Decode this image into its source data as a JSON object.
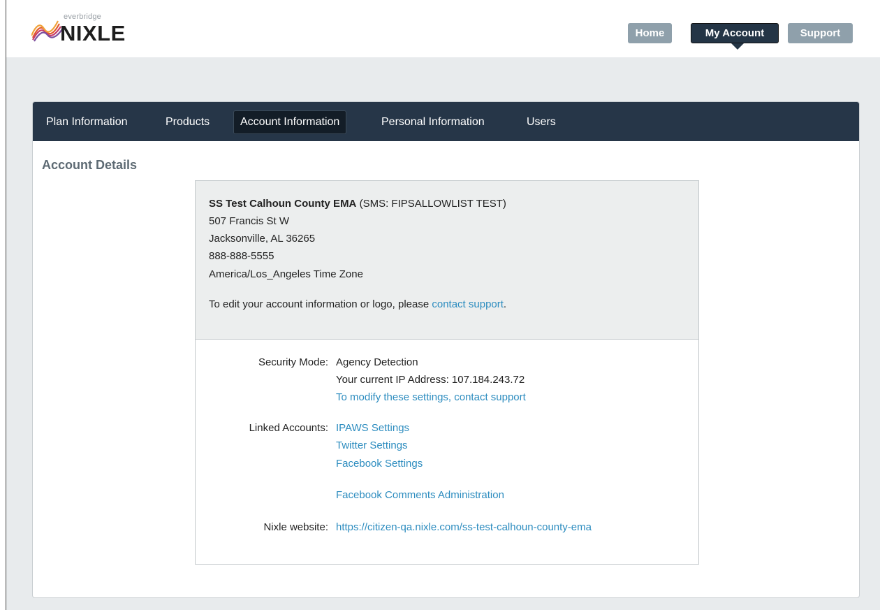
{
  "header": {
    "logo_small": "everbridge",
    "logo_big": "NIXLE",
    "nav": {
      "home": "Home",
      "my_account": "My Account",
      "support": "Support"
    }
  },
  "tabs": [
    "Plan Information",
    "Products",
    "Account Information",
    "Personal Information",
    "Users"
  ],
  "active_tab": "Account Information",
  "section_title": "Account Details",
  "account": {
    "name": "SS Test Calhoun County EMA",
    "sms_note": "(SMS: FIPSALLOWLIST TEST)",
    "address1": "507 Francis St W",
    "address2": "Jacksonville, AL 36265",
    "phone": "888-888-5555",
    "timezone": "America/Los_Angeles Time Zone",
    "edit_note": "To edit your account information or logo, please",
    "edit_link": "contact support",
    "edit_suffix": "."
  },
  "security": {
    "label": "Security Mode:",
    "mode": "Agency Detection",
    "ip_text": "Your current IP Address: 107.184.243.72",
    "modify_link": "To modify these settings, contact support"
  },
  "linked": {
    "label": "Linked Accounts:",
    "ipaws": "IPAWS Settings",
    "twitter": "Twitter Settings",
    "facebook": "Facebook Settings",
    "facebook_comments": "Facebook Comments Administration"
  },
  "website": {
    "label": "Nixle website:",
    "url": "https://citizen-qa.nixle.com/ss-test-calhoun-county-ema"
  },
  "colors": {
    "nav_dark": "#243546",
    "nav_muted": "#8fa0ab",
    "link": "#2c8cbf"
  }
}
